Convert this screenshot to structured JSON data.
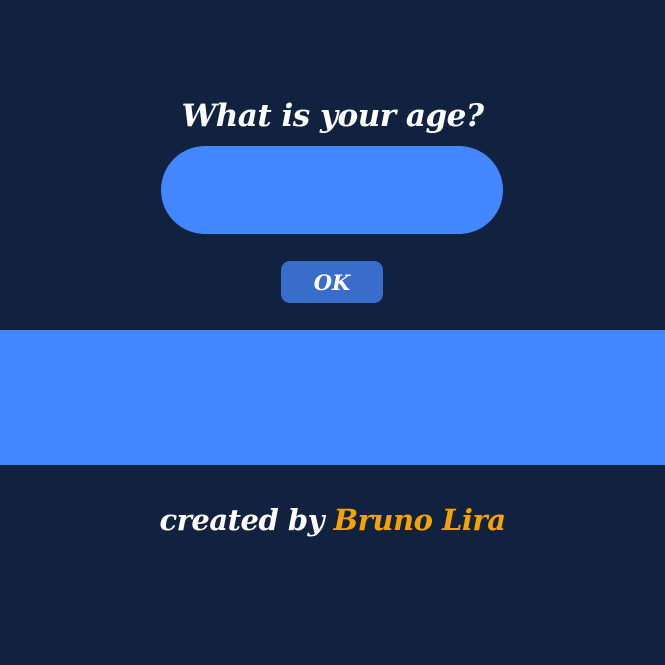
{
  "prompt": {
    "question": "What is your age?"
  },
  "age_input": {
    "value": "",
    "placeholder": ""
  },
  "ok_button": {
    "label": "OK"
  },
  "result": {
    "text": ""
  },
  "footer": {
    "prefix": "created by",
    "author": "Bruno Lira"
  },
  "colors": {
    "background": "#112241",
    "accent": "#4486fe",
    "button": "#386dcb",
    "author_highlight": "#f5a300",
    "text": "#ffffff"
  }
}
